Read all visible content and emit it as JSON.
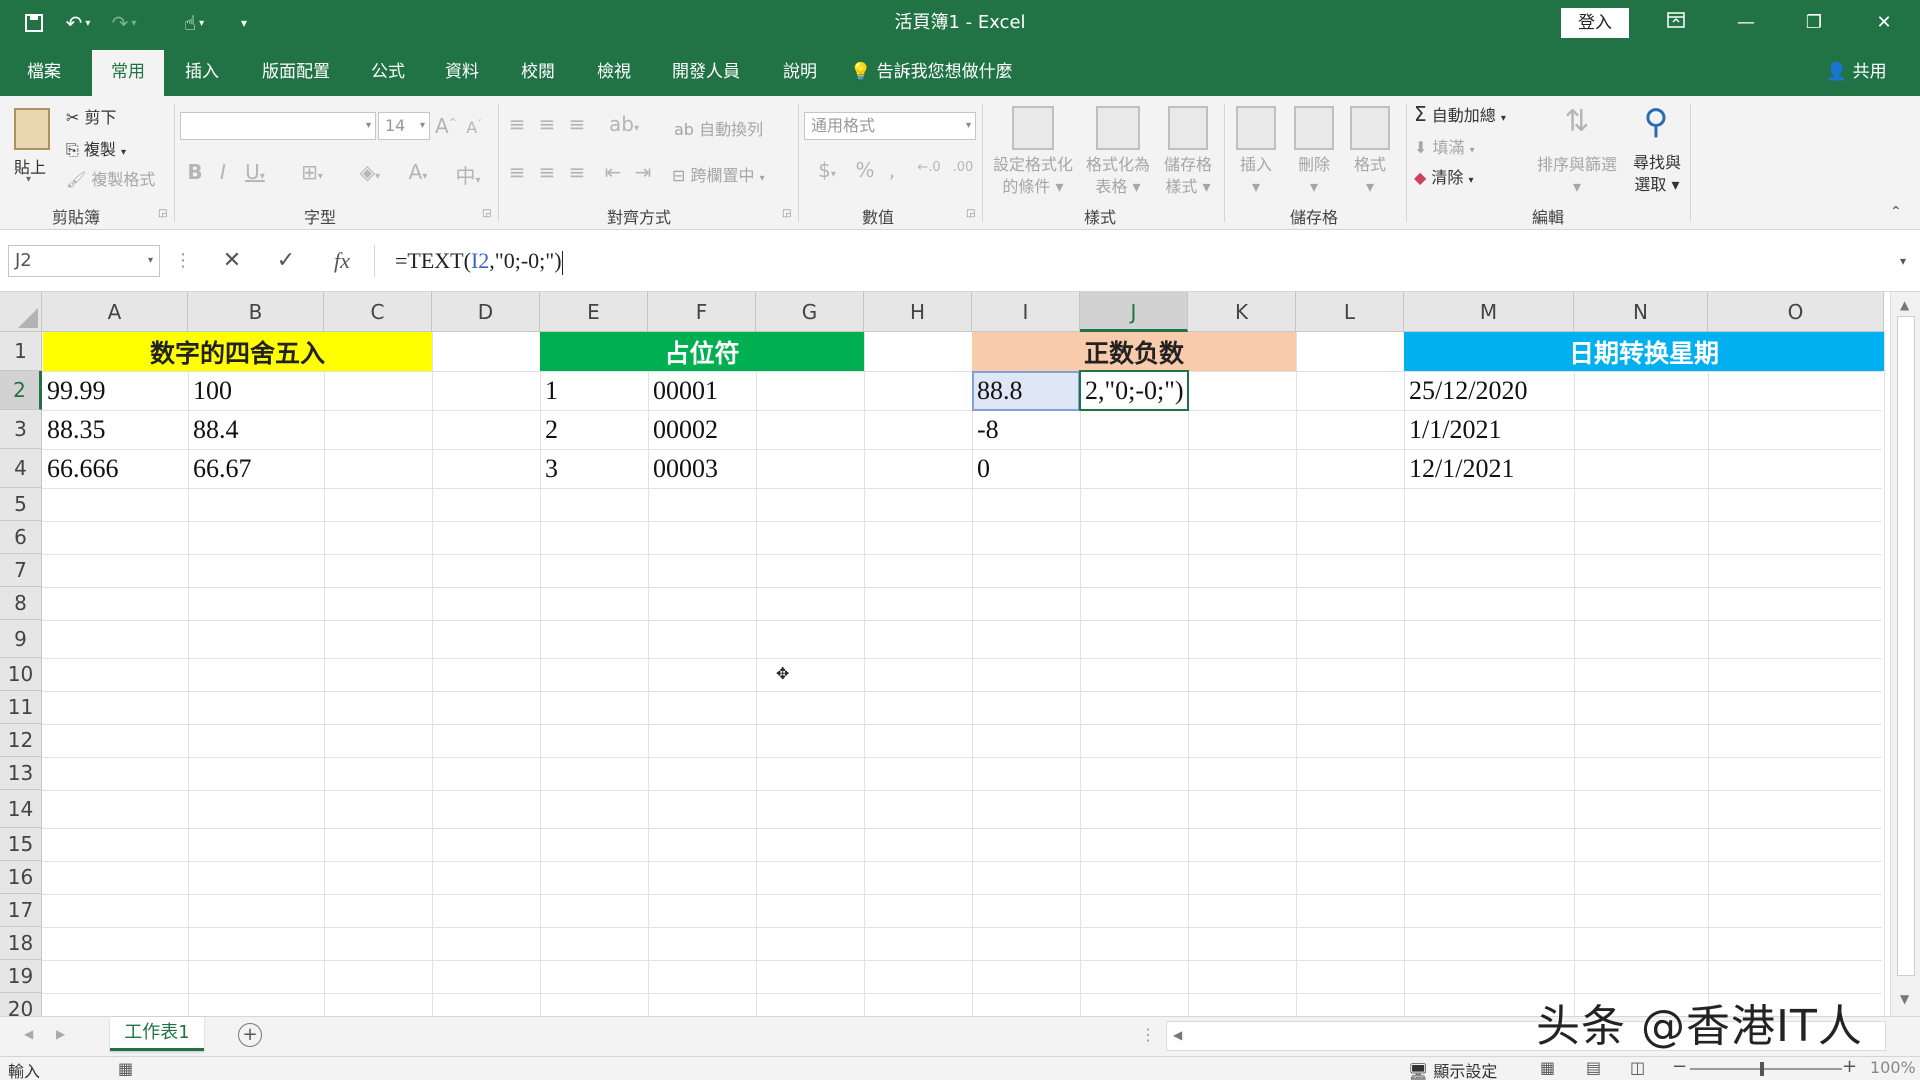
{
  "app": {
    "title": "活頁簿1  -  Excel",
    "login": "登入"
  },
  "tabs": [
    "檔案",
    "常用",
    "插入",
    "版面配置",
    "公式",
    "資料",
    "校閱",
    "檢視",
    "開發人員",
    "說明"
  ],
  "active_tab": "常用",
  "tell_me": "告訴我您想做什麼",
  "share": "共用",
  "ribbon": {
    "clipboard": {
      "paste": "貼上",
      "cut": "剪下",
      "copy": "複製",
      "format_painter": "複製格式",
      "label": "剪貼簿"
    },
    "font": {
      "size": "14",
      "label": "字型"
    },
    "alignment": {
      "wrap": "自動換列",
      "merge": "跨欄置中",
      "label": "對齊方式"
    },
    "number": {
      "format": "通用格式",
      "label": "數值"
    },
    "styles": {
      "conditional": [
        "設定格式化",
        "的條件"
      ],
      "as_table": [
        "格式化為",
        "表格"
      ],
      "cell_styles": [
        "儲存格",
        "樣式"
      ],
      "label": "樣式"
    },
    "cells": {
      "insert": "插入",
      "delete": "刪除",
      "format": "格式",
      "label": "儲存格"
    },
    "editing": {
      "autosum": "自動加總",
      "fill": "填滿",
      "clear": "清除",
      "sort": "排序與篩選",
      "find": [
        "尋找與",
        "選取"
      ],
      "label": "編輯"
    }
  },
  "formula_bar": {
    "name_box": "J2",
    "formula_prefix": "=TEXT(",
    "formula_ref": "I2",
    "formula_suffix": ",\"0;-0;\")"
  },
  "columns": [
    "A",
    "B",
    "C",
    "D",
    "E",
    "F",
    "G",
    "H",
    "I",
    "J",
    "K",
    "L",
    "M",
    "N",
    "O"
  ],
  "rows": [
    "1",
    "2",
    "3",
    "4",
    "5",
    "6",
    "7",
    "8",
    "9",
    "10",
    "11",
    "12",
    "13",
    "14",
    "15",
    "16",
    "17",
    "18",
    "19",
    "20"
  ],
  "selected_cell": "J2",
  "headers": {
    "rounding": {
      "text": "数字的四舍五入",
      "color": "#ffff00"
    },
    "placeholder": {
      "text": "占位符",
      "color": "#00b050"
    },
    "sign": {
      "text": "正数负数",
      "color": "#f8cbad"
    },
    "weekday": {
      "text": "日期转换星期",
      "color": "#00b0f0"
    }
  },
  "cells": {
    "A2": "99.99",
    "B2": "100",
    "A3": "88.35",
    "B3": "88.4",
    "A4": "66.666",
    "B4": "66.67",
    "E2": "1",
    "F2": "00001",
    "E3": "2",
    "F3": "00002",
    "E4": "3",
    "F4": "00003",
    "I2": "88.8",
    "J2": "2,\"0;-0;\")",
    "I3": "-8",
    "I4": "0",
    "M2": "25/12/2020",
    "M3": "1/1/2021",
    "M4": "12/1/2021"
  },
  "sheet_tab": "工作表1",
  "status": {
    "mode": "輸入",
    "display_settings": "顯示設定",
    "zoom": "100%"
  },
  "watermark": "头条 @香港IT人"
}
